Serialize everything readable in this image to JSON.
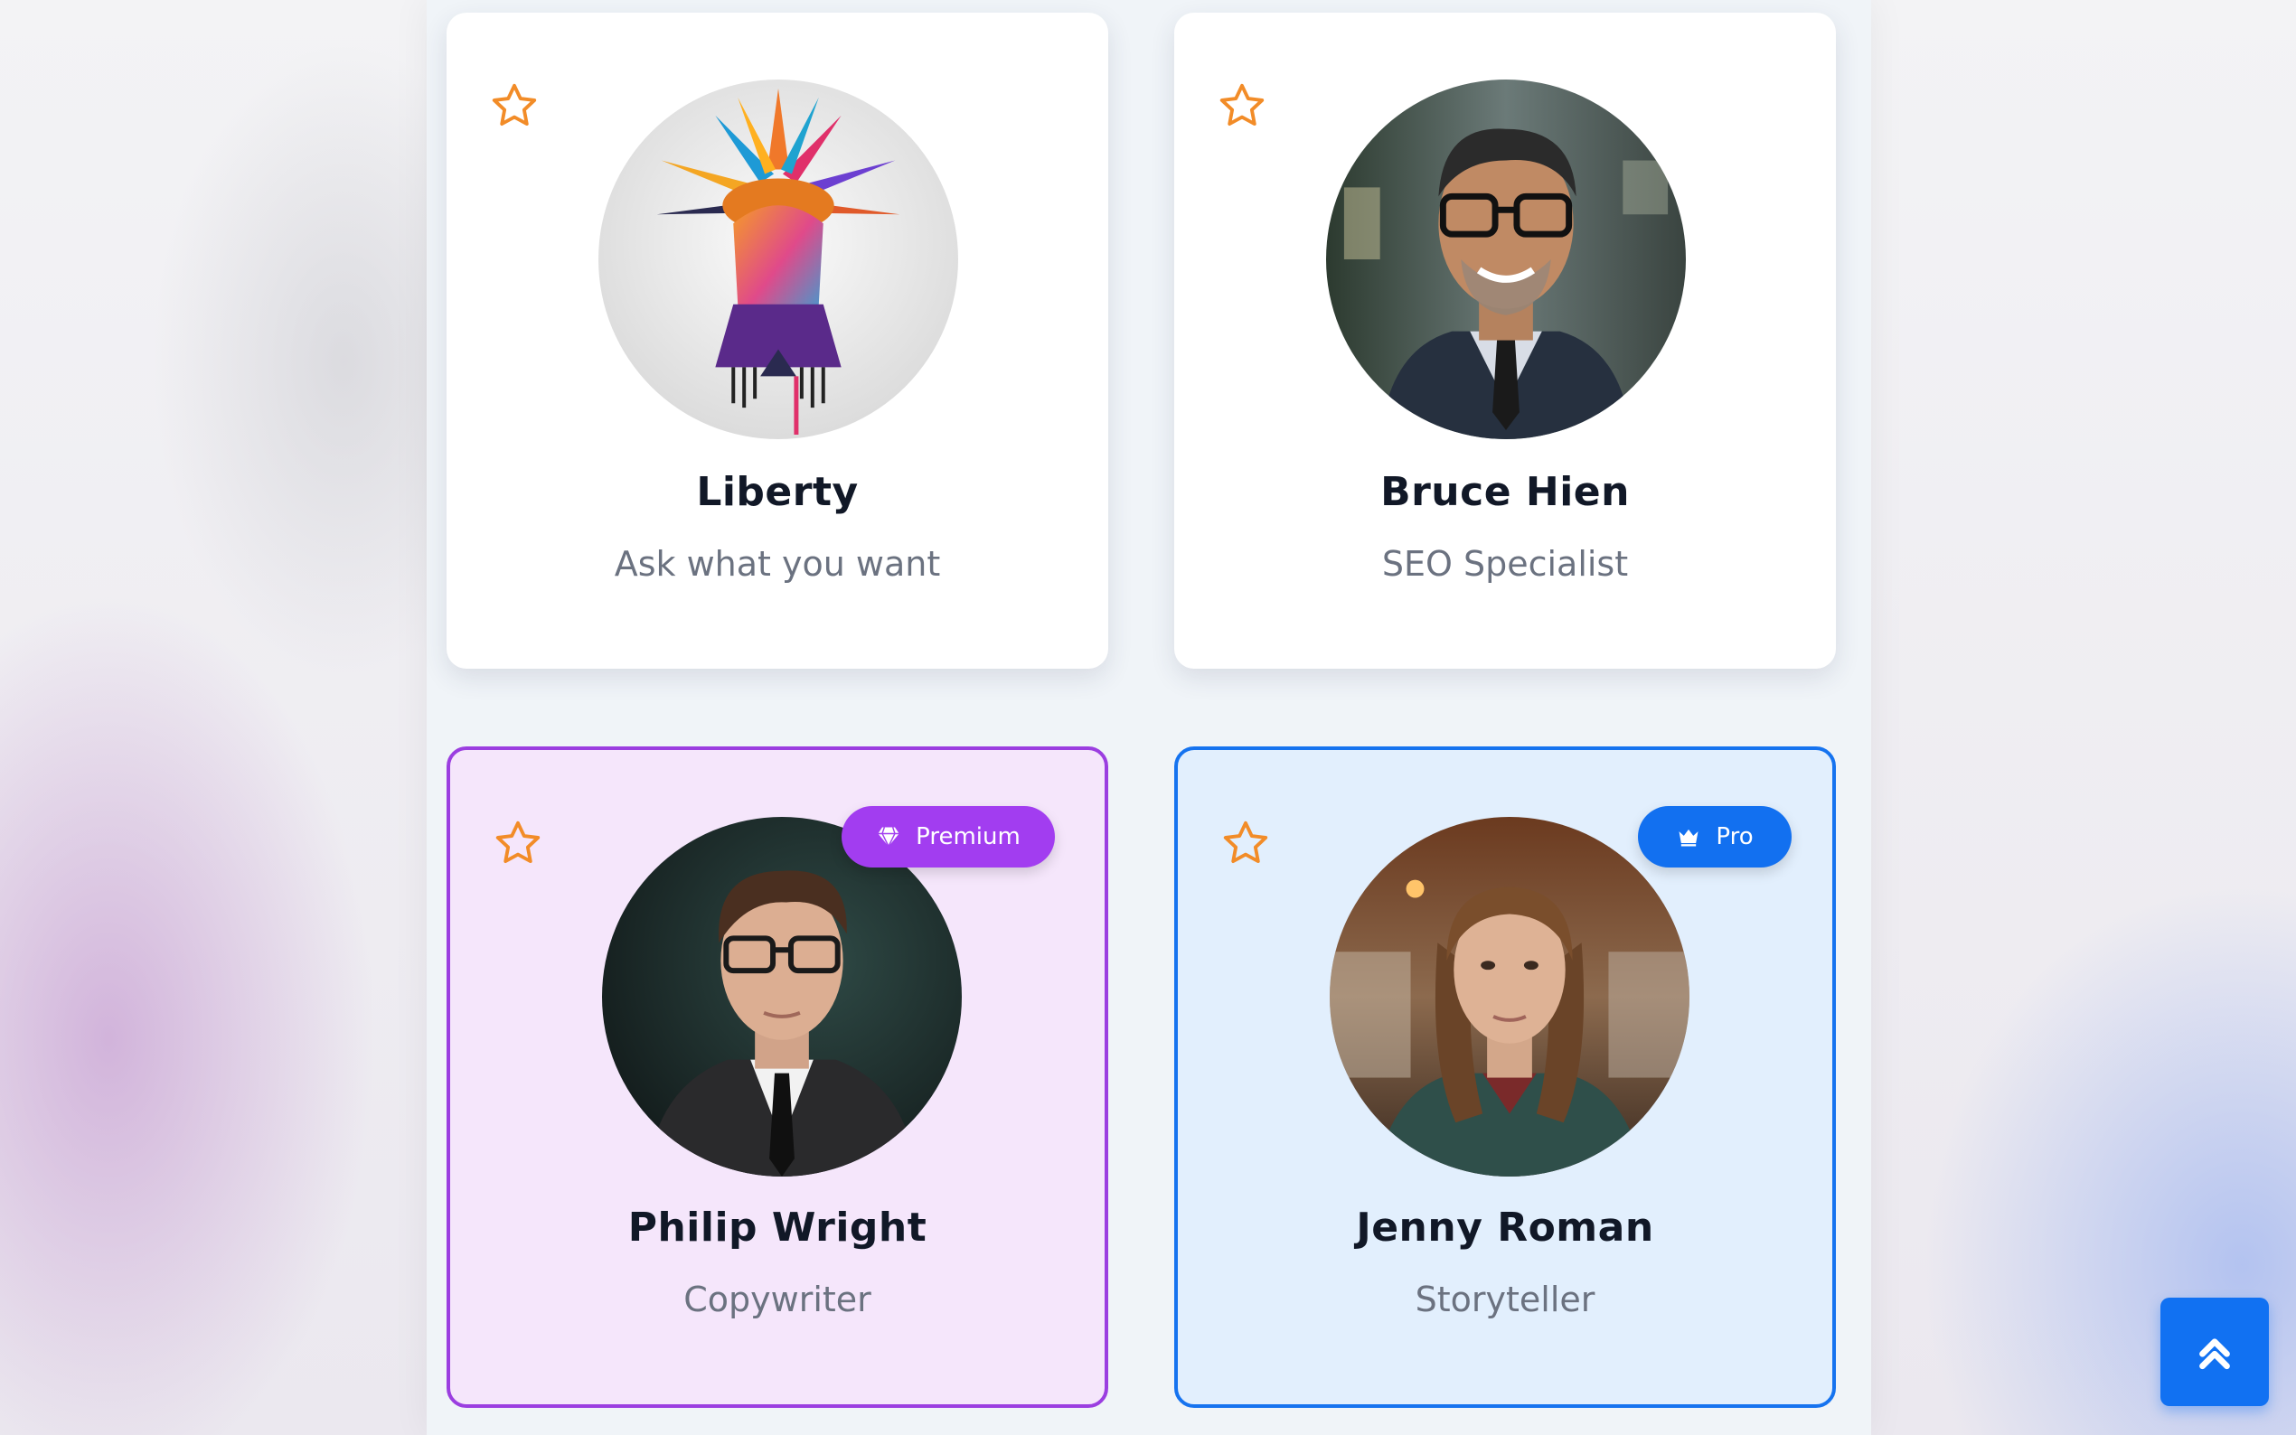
{
  "colors": {
    "star": "#f28c28",
    "premium": "#a23df0",
    "pro": "#1270f0",
    "scroll_button": "#1171f2"
  },
  "cards": [
    {
      "name": "Liberty",
      "role": "Ask what you want",
      "favorite_icon": "star-outline-icon"
    },
    {
      "name": "Bruce Hien",
      "role": "SEO Specialist",
      "favorite_icon": "star-outline-icon"
    },
    {
      "name": "Philip Wright",
      "role": "Copywriter",
      "favorite_icon": "star-outline-icon",
      "badge": {
        "label": "Premium",
        "icon": "diamond-icon"
      }
    },
    {
      "name": "Jenny Roman",
      "role": "Storyteller",
      "favorite_icon": "star-outline-icon",
      "badge": {
        "label": "Pro",
        "icon": "crown-icon"
      }
    }
  ],
  "scroll_top": {
    "icon": "double-chevron-up-icon"
  }
}
